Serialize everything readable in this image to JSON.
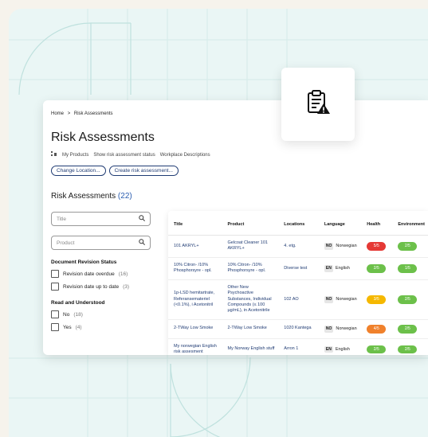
{
  "breadcrumb": {
    "home": "Home",
    "sep": ">",
    "current": "Risk Assessments"
  },
  "page_title": "Risk Assessments",
  "subnav": {
    "items": [
      "My Products",
      "Show risk assessment status",
      "Workplace Descriptions"
    ]
  },
  "actions": {
    "change_location": "Change Location...",
    "create": "Create risk assessment..."
  },
  "list": {
    "title": "Risk Assessments",
    "count": "(22)"
  },
  "filters": {
    "title_placeholder": "Title",
    "product_placeholder": "Product",
    "revision_heading": "Document Revision Status",
    "revision_overdue": "Revision date overdue",
    "revision_overdue_count": "(16)",
    "revision_uptodate": "Revision date up to date",
    "revision_uptodate_count": "(3)",
    "read_heading": "Read and Understood",
    "no": "No",
    "no_count": "(18)",
    "yes": "Yes",
    "yes_count": "(4)"
  },
  "table": {
    "headers": [
      "Title",
      "Product",
      "Locations",
      "Language",
      "Health",
      "Environment"
    ],
    "rows": [
      {
        "title": "101 AKRYL+",
        "product": "Gelcoat Cleaner 101 AKRYL+",
        "location": "4. etg.",
        "lang_code": "NO",
        "lang": "Norwegian",
        "health": "5/5",
        "health_color": "#e53935",
        "env": "2/5",
        "env_color": "#6cc04a"
      },
      {
        "title": "10% Citron- /10% Phosphorsyre - opl.",
        "product": "10% Citron- /10% Phosphorsyre - opl.",
        "location": "Diverse test",
        "lang_code": "EN",
        "lang": "English",
        "health": "2/5",
        "health_color": "#6cc04a",
        "env": "1/5",
        "env_color": "#6cc04a"
      },
      {
        "title": "1p-LSD hemitartrate, Referansemateriel (<0.1%), i Acetonitril",
        "product": "Other New Psychoactive Substances, Individual Compounds (≤ 100 µg/mL), in Acetonitrile",
        "location": "102 AO",
        "lang_code": "NO",
        "lang": "Norwegian",
        "health": "3/5",
        "health_color": "#f5b800",
        "env": "2/5",
        "env_color": "#6cc04a"
      },
      {
        "title": "2-TWay Low Smoke",
        "product": "2-TWay Low Smoke",
        "location": "1020 Kantega",
        "lang_code": "NO",
        "lang": "Norwegian",
        "health": "4/5",
        "health_color": "#f0812c",
        "env": "2/5",
        "env_color": "#6cc04a"
      },
      {
        "title": "My norwegian English risk assesment",
        "product": "My Norway English stuff",
        "location": "Arron 1",
        "lang_code": "EN",
        "lang": "English",
        "health": "2/5",
        "health_color": "#6cc04a",
        "env": "2/5",
        "env_color": "#6cc04a"
      }
    ]
  },
  "icons": {
    "floating": "clipboard-warning-icon",
    "search": "search-icon",
    "subnav": "products-icon"
  },
  "colors": {
    "accent": "#1f3b73",
    "count": "#2a5db0",
    "bg": "#eaf6f5"
  }
}
